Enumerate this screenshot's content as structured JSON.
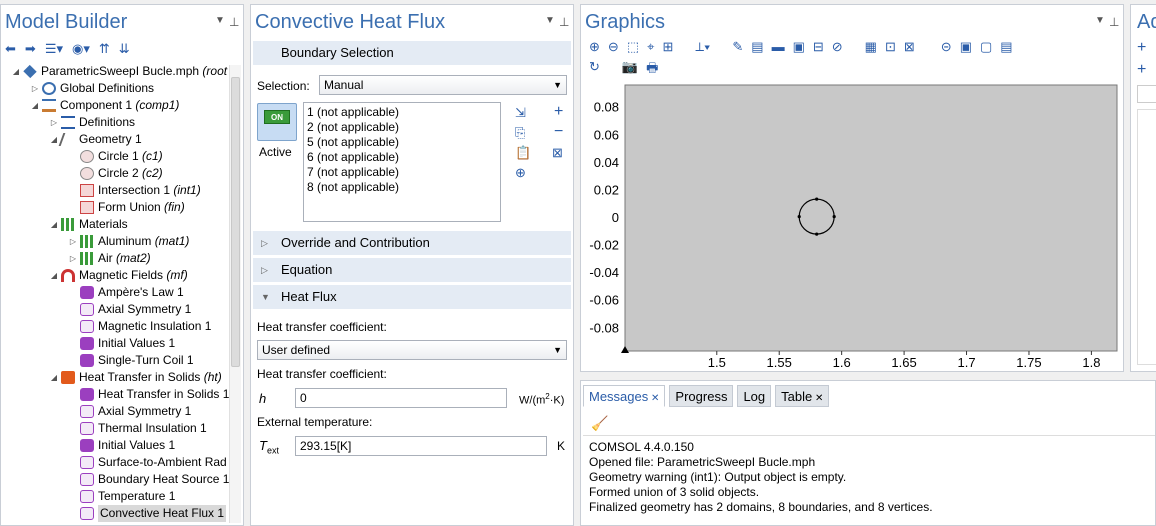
{
  "model_builder": {
    "title": "Model Builder",
    "tree": [
      {
        "label": "ParametricSweepI Bucle.mph",
        "tag": "(root",
        "level": 0,
        "icon": "model-root-icon",
        "expander": "open"
      },
      {
        "label": "Global Definitions",
        "tag": "",
        "level": 1,
        "icon": "globe-icon",
        "expander": "closed"
      },
      {
        "label": "Component 1",
        "tag": "(comp1)",
        "level": 1,
        "icon": "component-icon",
        "expander": "open"
      },
      {
        "label": "Definitions",
        "tag": "",
        "level": 2,
        "icon": "definitions-icon",
        "expander": "closed"
      },
      {
        "label": "Geometry 1",
        "tag": "",
        "level": 2,
        "icon": "geometry-icon",
        "expander": "open"
      },
      {
        "label": "Circle 1",
        "tag": "(c1)",
        "level": 3,
        "icon": "circle-icon",
        "expander": ""
      },
      {
        "label": "Circle 2",
        "tag": "(c2)",
        "level": 3,
        "icon": "circle-icon",
        "expander": ""
      },
      {
        "label": "Intersection 1",
        "tag": "(int1)",
        "level": 3,
        "icon": "intersection-icon",
        "expander": ""
      },
      {
        "label": "Form Union",
        "tag": "(fin)",
        "level": 3,
        "icon": "form-union-icon",
        "expander": ""
      },
      {
        "label": "Materials",
        "tag": "",
        "level": 2,
        "icon": "materials-icon",
        "expander": "open"
      },
      {
        "label": "Aluminum",
        "tag": "(mat1)",
        "level": 3,
        "icon": "material-icon",
        "expander": "closed"
      },
      {
        "label": "Air",
        "tag": "(mat2)",
        "level": 3,
        "icon": "material-icon",
        "expander": "closed"
      },
      {
        "label": "Magnetic Fields",
        "tag": "(mf)",
        "level": 2,
        "icon": "magnet-icon",
        "expander": "open"
      },
      {
        "label": "Ampère's Law 1",
        "tag": "",
        "level": 3,
        "icon": "domain-feature-icon",
        "expander": ""
      },
      {
        "label": "Axial Symmetry 1",
        "tag": "",
        "level": 3,
        "icon": "boundary-feature-icon",
        "expander": ""
      },
      {
        "label": "Magnetic Insulation 1",
        "tag": "",
        "level": 3,
        "icon": "boundary-feature-icon",
        "expander": ""
      },
      {
        "label": "Initial Values 1",
        "tag": "",
        "level": 3,
        "icon": "domain-feature-icon",
        "expander": ""
      },
      {
        "label": "Single-Turn Coil 1",
        "tag": "",
        "level": 3,
        "icon": "domain-feature-icon",
        "expander": ""
      },
      {
        "label": "Heat Transfer in Solids",
        "tag": "(ht)",
        "level": 2,
        "icon": "heat-transfer-icon",
        "expander": "open"
      },
      {
        "label": "Heat Transfer in Solids 1",
        "tag": "",
        "level": 3,
        "icon": "domain-feature-icon",
        "expander": ""
      },
      {
        "label": "Axial Symmetry 1",
        "tag": "",
        "level": 3,
        "icon": "boundary-feature-icon",
        "expander": ""
      },
      {
        "label": "Thermal Insulation 1",
        "tag": "",
        "level": 3,
        "icon": "boundary-feature-icon",
        "expander": ""
      },
      {
        "label": "Initial Values 1",
        "tag": "",
        "level": 3,
        "icon": "domain-feature-icon",
        "expander": ""
      },
      {
        "label": "Surface-to-Ambient Rad",
        "tag": "",
        "level": 3,
        "icon": "boundary-feature-icon",
        "expander": ""
      },
      {
        "label": "Boundary Heat Source 1",
        "tag": "",
        "level": 3,
        "icon": "boundary-feature-icon",
        "expander": ""
      },
      {
        "label": "Temperature 1",
        "tag": "",
        "level": 3,
        "icon": "boundary-feature-icon",
        "expander": ""
      },
      {
        "label": "Convective Heat Flux 1",
        "tag": "",
        "level": 3,
        "icon": "boundary-feature-icon",
        "expander": "",
        "selected": true
      }
    ]
  },
  "settings": {
    "title": "Convective Heat Flux",
    "boundary_selection": "Boundary Selection",
    "selection_label": "Selection:",
    "selection_value": "Manual",
    "active_label": "Active",
    "active_switch": "ON",
    "selection_items": [
      "1 (not applicable)",
      "2 (not applicable)",
      "5 (not applicable)",
      "6 (not applicable)",
      "7 (not applicable)",
      "8 (not applicable)"
    ],
    "override": "Override and Contribution",
    "equation": "Equation",
    "heat_flux": "Heat Flux",
    "htc_label_1": "Heat transfer coefficient:",
    "htc_select": "User defined",
    "htc_label_2": "Heat transfer coefficient:",
    "h_symbol": "h",
    "h_value": "0",
    "h_unit_base": "W/(m",
    "h_unit_exp": "2",
    "h_unit_tail": "·K)",
    "ext_temp_label": "External temperature:",
    "t_symbol": "T",
    "t_sub": "ext",
    "t_value": "293.15[K]",
    "t_unit": "K"
  },
  "graphics": {
    "title": "Graphics",
    "plot": {
      "x_ticks": [
        "1.5",
        "1.55",
        "1.6",
        "1.65",
        "1.7",
        "1.75",
        "1.8"
      ],
      "y_ticks": [
        "0.08",
        "0.06",
        "0.04",
        "0.02",
        "0",
        "-0.02",
        "-0.04",
        "-0.06",
        "-0.08"
      ],
      "x_values": [
        1.5,
        1.55,
        1.6,
        1.65,
        1.7,
        1.75,
        1.8
      ],
      "y_values": [
        0.08,
        0.06,
        0.04,
        0.02,
        0,
        -0.02,
        -0.04,
        -0.06,
        -0.08
      ],
      "circle": {
        "cx": 1.58,
        "cy": 0.001,
        "r": 0.014
      },
      "background": "#c8c8c8"
    }
  },
  "messages": {
    "tabs": [
      "Messages",
      "Progress",
      "Log",
      "Table"
    ],
    "lines": [
      "COMSOL 4.4.0.150",
      "Opened file: ParametricSweepI Bucle.mph",
      "Geometry warning (int1): Output object is empty.",
      "Formed union of 3 solid objects.",
      "Finalized geometry has 2 domains, 8 boundaries, and 8 vertices."
    ]
  },
  "add_pane": {
    "title": "Ad"
  },
  "colors": {
    "accent": "#3b6fb0",
    "header_bg": "#e4ebf4",
    "selected": "#d9d9d9"
  }
}
